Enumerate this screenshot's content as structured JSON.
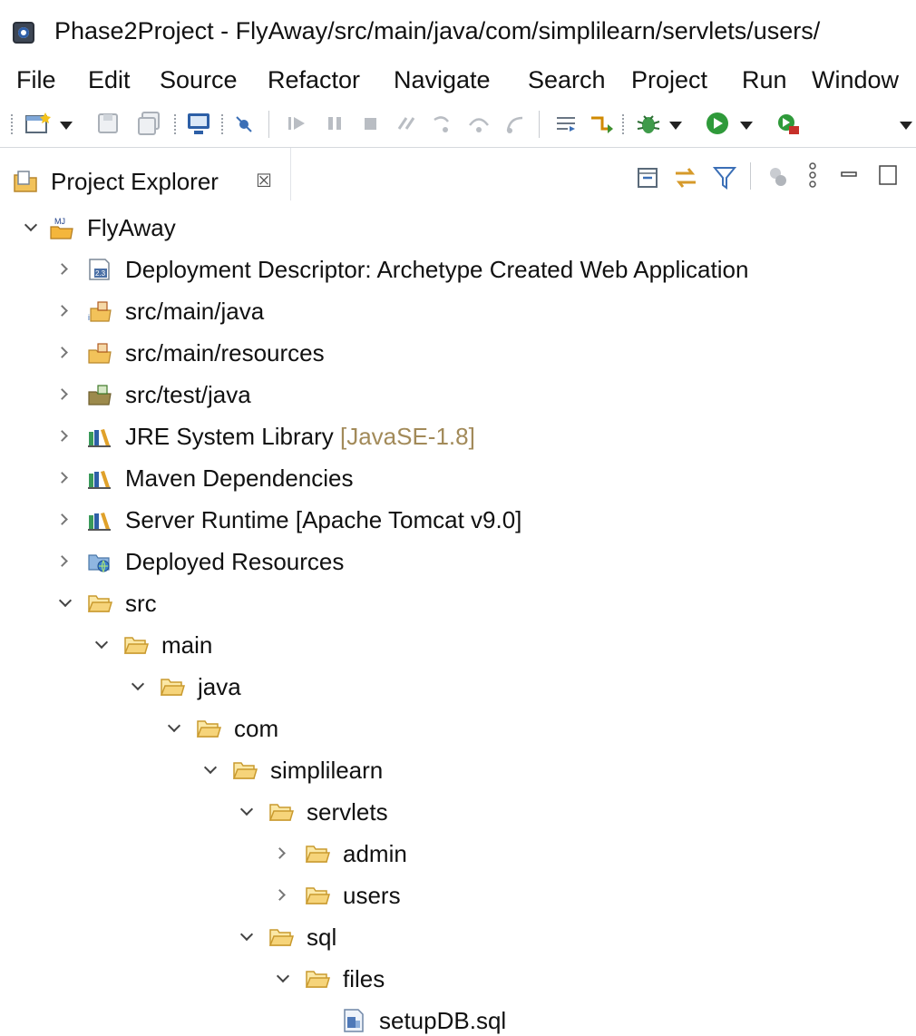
{
  "window": {
    "title": "Phase2Project - FlyAway/src/main/java/com/simplilearn/servlets/users/"
  },
  "menu": [
    "File",
    "Edit",
    "Source",
    "Refactor",
    "Navigate",
    "Search",
    "Project",
    "Run",
    "Window"
  ],
  "toolbar_icons": [
    "new-icon",
    "save-icon",
    "save-all-icon",
    "console-icon",
    "skip-breakpoints-icon",
    "resume-icon",
    "suspend-icon",
    "terminate-icon",
    "disconnect-icon",
    "step-into-icon",
    "step-over-icon",
    "step-return-icon",
    "drop-to-frame-icon",
    "use-step-filters-icon",
    "debug-icon",
    "run-icon",
    "external-tools-icon"
  ],
  "view": {
    "title": "Project Explorer",
    "close_glyph": "☒"
  },
  "tree": [
    {
      "label": "FlyAway",
      "state": "expanded",
      "icon": "maven-project-icon"
    },
    {
      "label": "Deployment Descriptor: Archetype Created Web Application",
      "state": "collapsed",
      "icon": "deployment-descriptor-icon"
    },
    {
      "label": "src/main/java",
      "state": "collapsed",
      "icon": "source-folder-icon"
    },
    {
      "label": "src/main/resources",
      "state": "collapsed",
      "icon": "source-folder-icon"
    },
    {
      "label": "src/test/java",
      "state": "collapsed",
      "icon": "test-source-folder-icon"
    },
    {
      "label": "JRE System Library",
      "decoration": "[JavaSE-1.8]",
      "state": "collapsed",
      "icon": "library-icon"
    },
    {
      "label": "Maven Dependencies",
      "state": "collapsed",
      "icon": "library-icon"
    },
    {
      "label": "Server Runtime [Apache Tomcat v9.0]",
      "state": "collapsed",
      "icon": "library-icon"
    },
    {
      "label": "Deployed Resources",
      "state": "collapsed",
      "icon": "deployed-resources-icon"
    },
    {
      "label": "src",
      "state": "expanded",
      "icon": "folder-icon"
    },
    {
      "label": "main",
      "state": "expanded",
      "icon": "folder-icon"
    },
    {
      "label": "java",
      "state": "expanded",
      "icon": "folder-icon"
    },
    {
      "label": "com",
      "state": "expanded",
      "icon": "folder-icon"
    },
    {
      "label": "simplilearn",
      "state": "expanded",
      "icon": "folder-icon"
    },
    {
      "label": "servlets",
      "state": "expanded",
      "icon": "folder-icon"
    },
    {
      "label": "admin",
      "state": "collapsed",
      "icon": "folder-icon"
    },
    {
      "label": "users",
      "state": "collapsed",
      "icon": "folder-icon"
    },
    {
      "label": "sql",
      "state": "expanded",
      "icon": "folder-icon"
    },
    {
      "label": "files",
      "state": "expanded",
      "icon": "folder-icon"
    },
    {
      "label": "setupDB.sql",
      "state": "leaf",
      "icon": "sql-file-icon"
    }
  ]
}
